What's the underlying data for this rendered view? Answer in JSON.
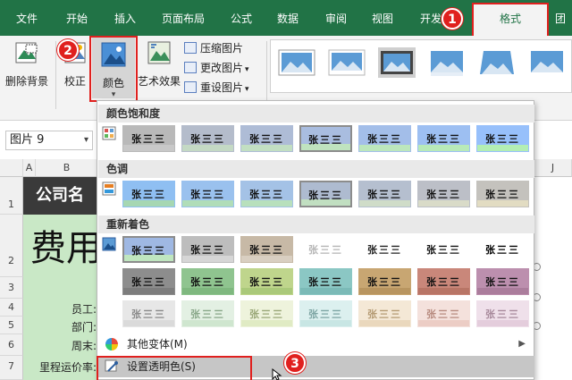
{
  "tabs": [
    "文件",
    "开始",
    "插入",
    "页面布局",
    "公式",
    "数据",
    "审阅",
    "视图",
    "开发",
    "格式",
    "团"
  ],
  "active_tab": "格式",
  "badges": [
    "1",
    "2",
    "3"
  ],
  "ribbon": {
    "remove_bg": "删除背景",
    "correct": "校正",
    "color": "颜色",
    "artistic": "艺术效果",
    "compress": "压缩图片",
    "change": "更改图片",
    "reset": "重设图片"
  },
  "name_box": "图片 9",
  "columns": [
    "A",
    "B",
    "J"
  ],
  "rows": [
    "1",
    "2",
    "3",
    "4",
    "5",
    "6",
    "7"
  ],
  "sheet": {
    "company": "公司名",
    "title": "费用",
    "labels": [
      "员工:",
      "部门:",
      "周末:",
      "里程运价率:"
    ]
  },
  "dropdown": {
    "saturation_title": "颜色饱和度",
    "tone_title": "色调",
    "recolor_title": "重新着色",
    "swatch_text": "张三三",
    "more_variants": "其他变体(M)",
    "set_transparent": "设置透明色(S)"
  },
  "colors": {
    "excel_green": "#217346",
    "highlight_red": "#e0201e",
    "saturation": [
      {
        "bg": "#b9b9b9",
        "band": "#c8c8c8"
      },
      {
        "bg": "#b4bccb",
        "band": "#c4d9c4"
      },
      {
        "bg": "#aebcd6",
        "band": "#c2dfc2"
      },
      {
        "bg": "#a9bde0",
        "band": "#bfe3bf"
      },
      {
        "bg": "#a3bee9",
        "band": "#bce7bc"
      },
      {
        "bg": "#9dbff2",
        "band": "#b8eab8"
      },
      {
        "bg": "#97c0fb",
        "band": "#b3eeb3"
      }
    ],
    "tone": [
      {
        "bg": "#8fbff2",
        "band": "#a6d7b2"
      },
      {
        "bg": "#9ac1ee",
        "band": "#b0ddb8"
      },
      {
        "bg": "#a4c2e6",
        "band": "#b8e0bc"
      },
      {
        "bg": "#aebbd0",
        "band": "#c1dfc1"
      },
      {
        "bg": "#b5bfcf",
        "band": "#cfdcc8"
      },
      {
        "bg": "#bcbfc7",
        "band": "#d9dbc8"
      },
      {
        "bg": "#c4c2bd",
        "band": "#e2dcc2"
      }
    ],
    "recolor": [
      [
        {
          "bg": "#9fb8e3",
          "band": "#bfe6bf",
          "txt": "#111"
        },
        {
          "bg": "#bdbdbd",
          "band": "#d6d6d6",
          "txt": "#111"
        },
        {
          "bg": "#c7b9a6",
          "band": "#d9cfc1",
          "txt": "#111"
        },
        {
          "bg": "#ffffff",
          "band": "#ffffff",
          "txt": "#b5b5b5"
        },
        {
          "bg": "#ffffff",
          "band": "#ffffff",
          "txt": "#222"
        },
        {
          "bg": "#ffffff",
          "band": "#ffffff",
          "txt": "#111"
        },
        {
          "bg": "#ffffff",
          "band": "#ffffff",
          "txt": "#000"
        }
      ],
      [
        {
          "bg": "#8d8d8d",
          "band": "#7d7d7d",
          "txt": "#111"
        },
        {
          "bg": "#8fc48f",
          "band": "#7fb87f",
          "txt": "#111"
        },
        {
          "bg": "#bfd58c",
          "band": "#aac97a",
          "txt": "#111"
        },
        {
          "bg": "#8bc7c4",
          "band": "#7bbab7",
          "txt": "#111"
        },
        {
          "bg": "#c8a672",
          "band": "#b89560",
          "txt": "#111"
        },
        {
          "bg": "#c9877a",
          "band": "#b87566",
          "txt": "#111"
        },
        {
          "bg": "#bc8fae",
          "band": "#ab7d9c",
          "txt": "#111"
        }
      ],
      [
        {
          "bg": "#e7e7e7",
          "band": "#dadada",
          "txt": "#8a8a8a"
        },
        {
          "bg": "#e3f0e3",
          "band": "#cfe6cf",
          "txt": "#8aa88a"
        },
        {
          "bg": "#eef3dc",
          "band": "#e0ebc4",
          "txt": "#9aa878"
        },
        {
          "bg": "#dcf0ef",
          "band": "#c8e6e4",
          "txt": "#7ea6a4"
        },
        {
          "bg": "#f4e8d6",
          "band": "#ead8bd",
          "txt": "#b59b74"
        },
        {
          "bg": "#f4e1dc",
          "band": "#eccdc5",
          "txt": "#b88c80"
        },
        {
          "bg": "#efe0ea",
          "band": "#e4cddc",
          "txt": "#a88a9c"
        }
      ]
    ]
  }
}
